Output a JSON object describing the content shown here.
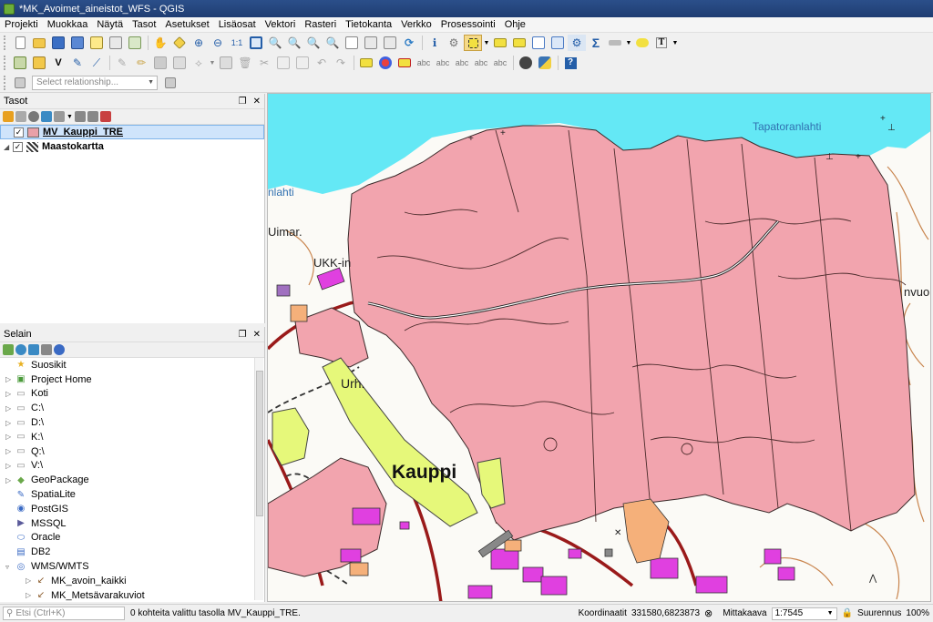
{
  "window": {
    "title": "*MK_Avoimet_aineistot_WFS - QGIS"
  },
  "menu": [
    "Projekti",
    "Muokkaa",
    "Näytä",
    "Tasot",
    "Asetukset",
    "Lisäosat",
    "Vektori",
    "Rasteri",
    "Tietokanta",
    "Verkko",
    "Prosessointi",
    "Ohje"
  ],
  "relation": {
    "placeholder": "Select relationship..."
  },
  "layers_panel": {
    "title": "Tasot",
    "layers": [
      {
        "name": "MV_Kauppi_TRE",
        "checked": true,
        "color": "#e8a0a8"
      },
      {
        "name": "Maastokartta",
        "checked": true
      }
    ]
  },
  "browser_panel": {
    "title": "Selain",
    "items": [
      {
        "label": "Suosikit",
        "icon": "star-icon"
      },
      {
        "label": "Project Home",
        "icon": "project-home-icon"
      },
      {
        "label": "Koti",
        "icon": "folder-icon"
      },
      {
        "label": "C:\\",
        "icon": "folder-icon"
      },
      {
        "label": "D:\\",
        "icon": "folder-icon"
      },
      {
        "label": "K:\\",
        "icon": "folder-icon"
      },
      {
        "label": "Q:\\",
        "icon": "folder-icon"
      },
      {
        "label": "V:\\",
        "icon": "folder-icon"
      },
      {
        "label": "GeoPackage",
        "icon": "geopackage-icon"
      },
      {
        "label": "SpatiaLite",
        "icon": "spatialite-icon"
      },
      {
        "label": "PostGIS",
        "icon": "postgis-icon"
      },
      {
        "label": "MSSQL",
        "icon": "mssql-icon"
      },
      {
        "label": "Oracle",
        "icon": "oracle-icon"
      },
      {
        "label": "DB2",
        "icon": "db2-icon"
      },
      {
        "label": "WMS/WMTS",
        "icon": "wms-icon"
      },
      {
        "label": "MK_avoin_kaikki",
        "icon": "wms-layer-icon"
      },
      {
        "label": "MK_Metsävarakuviot",
        "icon": "wms-layer-icon"
      }
    ]
  },
  "map": {
    "labels": {
      "tapatoranlahti": "Tapatoranlahti",
      "lahti": "nlahti",
      "uimar": "Uimar.",
      "ukk": "UKK-in",
      "urh": "Urh.",
      "kauppi": "Kauppi",
      "nvuo": "nvuo"
    },
    "colors": {
      "water": "#64e8f5",
      "polygon": "#f2a4ae",
      "field": "#e6f87a",
      "building": "#e040e0",
      "road": "#9a1a1a",
      "contour": "#c07030"
    }
  },
  "status": {
    "search_placeholder": "Etsi (Ctrl+K)",
    "message": "0 kohteita valittu tasolla MV_Kauppi_TRE.",
    "coord_label": "Koordinaatit",
    "coords": "331580,6823873",
    "scale_label": "Mittakaava",
    "scale": "1:7545",
    "zoom_label": "Suurennus",
    "zoom": "100%"
  }
}
